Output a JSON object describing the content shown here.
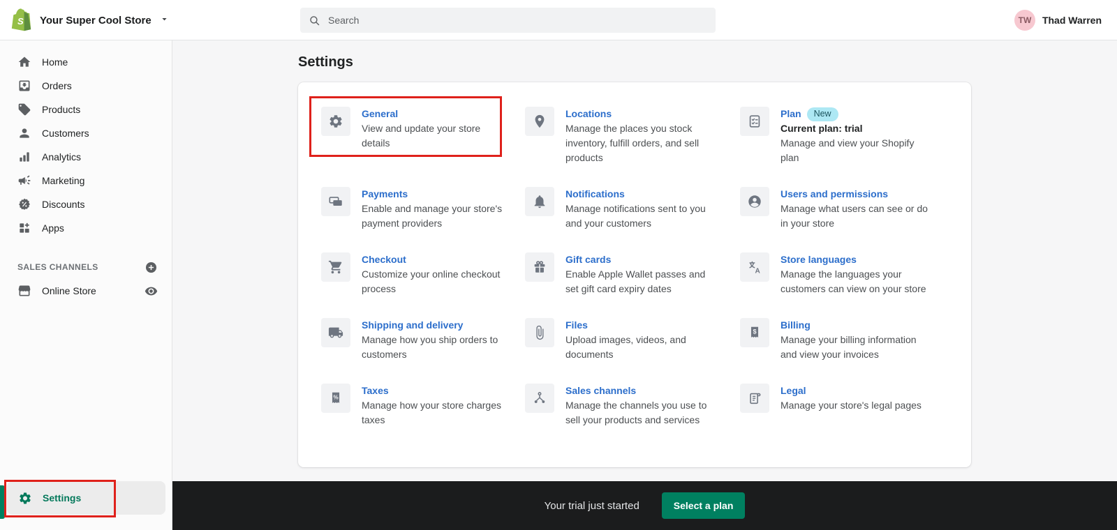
{
  "topbar": {
    "store_name": "Your Super Cool Store",
    "search_placeholder": "Search",
    "user_initials": "TW",
    "user_name": "Thad Warren"
  },
  "sidebar": {
    "items": [
      {
        "icon": "home-icon",
        "label": "Home"
      },
      {
        "icon": "orders-icon",
        "label": "Orders"
      },
      {
        "icon": "products-icon",
        "label": "Products"
      },
      {
        "icon": "customers-icon",
        "label": "Customers"
      },
      {
        "icon": "analytics-icon",
        "label": "Analytics"
      },
      {
        "icon": "marketing-icon",
        "label": "Marketing"
      },
      {
        "icon": "discounts-icon",
        "label": "Discounts"
      },
      {
        "icon": "apps-icon",
        "label": "Apps"
      }
    ],
    "sales_channels": {
      "heading": "SALES CHANNELS",
      "items": [
        {
          "icon": "storefront-icon",
          "label": "Online Store"
        }
      ]
    },
    "settings": {
      "icon": "gear-icon",
      "label": "Settings"
    }
  },
  "main": {
    "title": "Settings",
    "cards": [
      {
        "icon": "gear-icon",
        "title": "General",
        "description": "View and update your store details",
        "annotated": true
      },
      {
        "icon": "location-pin-icon",
        "title": "Locations",
        "description": "Manage the places you stock inventory, fulfill orders, and sell products"
      },
      {
        "icon": "plan-icon",
        "title": "Plan",
        "badge": "New",
        "subtitle": "Current plan: trial",
        "description": "Manage and view your Shopify plan"
      },
      {
        "icon": "payments-icon",
        "title": "Payments",
        "description": "Enable and manage your store's payment providers"
      },
      {
        "icon": "bell-icon",
        "title": "Notifications",
        "description": "Manage notifications sent to you and your customers"
      },
      {
        "icon": "user-circle-icon",
        "title": "Users and permissions",
        "description": "Manage what users can see or do in your store"
      },
      {
        "icon": "cart-icon",
        "title": "Checkout",
        "description": "Customize your online checkout process"
      },
      {
        "icon": "gift-icon",
        "title": "Gift cards",
        "description": "Enable Apple Wallet passes and set gift card expiry dates"
      },
      {
        "icon": "translate-icon",
        "title": "Store languages",
        "description": "Manage the languages your customers can view on your store"
      },
      {
        "icon": "truck-icon",
        "title": "Shipping and delivery",
        "description": "Manage how you ship orders to customers"
      },
      {
        "icon": "paperclip-icon",
        "title": "Files",
        "description": "Upload images, videos, and documents"
      },
      {
        "icon": "billing-icon",
        "title": "Billing",
        "description": "Manage your billing information and view your invoices"
      },
      {
        "icon": "taxes-icon",
        "title": "Taxes",
        "description": "Manage how your store charges taxes"
      },
      {
        "icon": "sales-channels-icon",
        "title": "Sales channels",
        "description": "Manage the channels you use to sell your products and services"
      },
      {
        "icon": "legal-icon",
        "title": "Legal",
        "description": "Manage your store's legal pages"
      }
    ]
  },
  "trial_bar": {
    "message": "Your trial just started",
    "button_label": "Select a plan"
  },
  "colors": {
    "accent_green": "#008060",
    "link_blue": "#2c6ecb",
    "badge_info_bg": "#ade8f4",
    "annotation_red": "#df211b",
    "shopify_logo_green": "#95bf47",
    "trial_bar_bg": "#1b1c1d"
  }
}
